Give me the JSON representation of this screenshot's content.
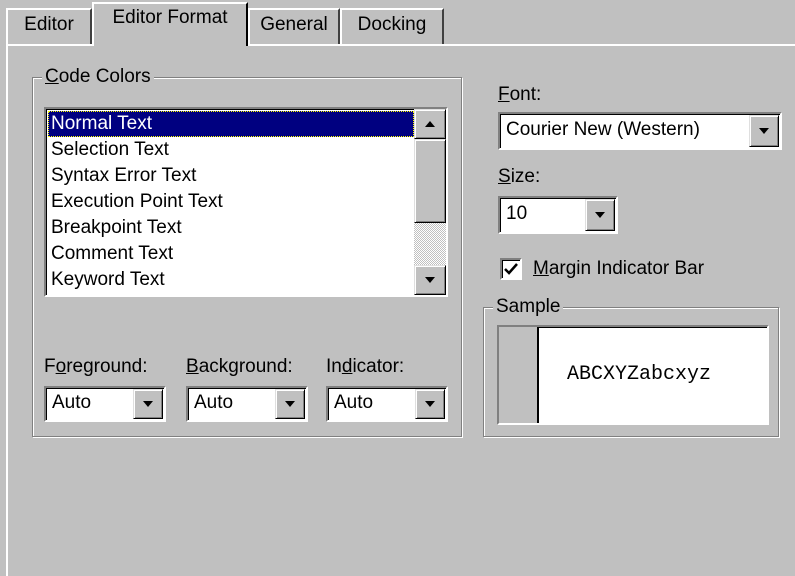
{
  "tabs": [
    {
      "label": "Editor"
    },
    {
      "label": "Editor Format",
      "active": true
    },
    {
      "label": "General"
    },
    {
      "label": "Docking"
    }
  ],
  "code_colors": {
    "legend_first": "C",
    "legend_rest": "ode Colors",
    "items": [
      {
        "label": "Normal Text",
        "selected": true
      },
      {
        "label": "Selection Text"
      },
      {
        "label": "Syntax Error Text"
      },
      {
        "label": "Execution Point Text"
      },
      {
        "label": "Breakpoint Text"
      },
      {
        "label": "Comment Text"
      },
      {
        "label": "Keyword Text"
      }
    ]
  },
  "foreground": {
    "label_pre": "F",
    "label_u": "o",
    "label_post": "reground:",
    "value": "Auto"
  },
  "background": {
    "label_pre": "",
    "label_u": "B",
    "label_post": "ackground:",
    "value": "Auto"
  },
  "indicator": {
    "label_pre": "In",
    "label_u": "d",
    "label_post": "icator:",
    "value": "Auto"
  },
  "font": {
    "label_u": "F",
    "label_post": "ont:",
    "value": "Courier New (Western)"
  },
  "size": {
    "label_u": "S",
    "label_post": "ize:",
    "value": "10"
  },
  "margin_bar": {
    "label_u": "M",
    "label_post": "argin Indicator Bar",
    "checked": true
  },
  "sample": {
    "legend": "Sample",
    "text": "ABCXYZabcxyz"
  },
  "colors": {
    "face": "#c0c0c0",
    "selection": "#000080",
    "window": "#ffffff"
  }
}
